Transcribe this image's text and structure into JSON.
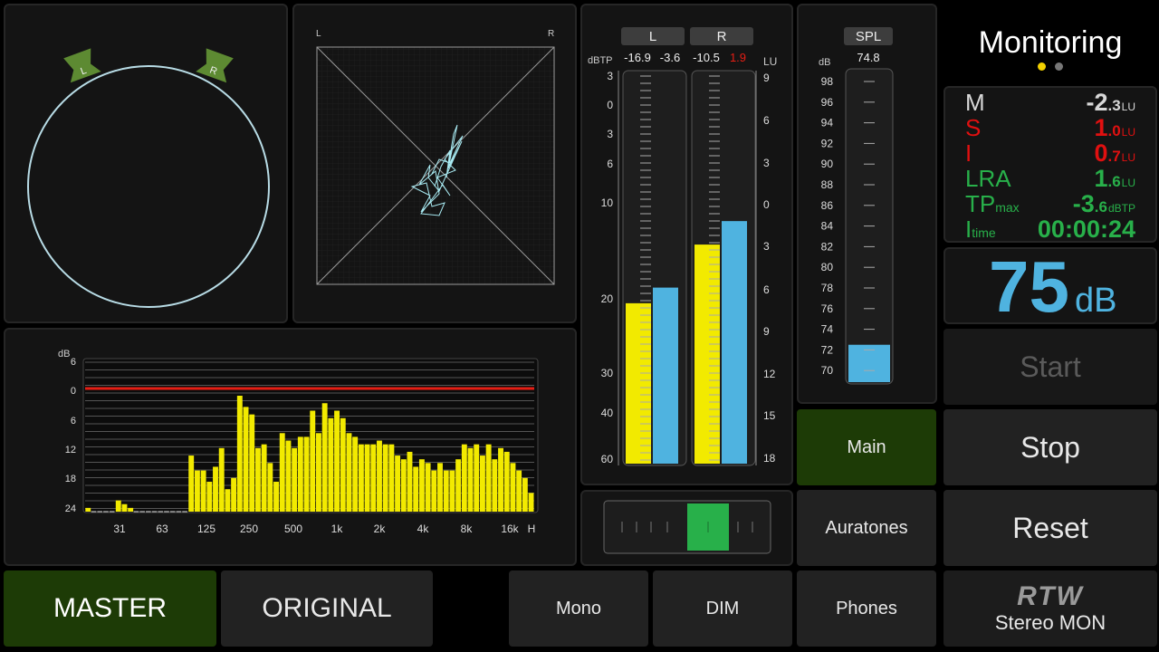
{
  "vector_scope": {
    "left_label": "L",
    "right_label": "R"
  },
  "xy_scope": {
    "left_label": "L",
    "right_label": "R"
  },
  "rta": {
    "unit": "dB",
    "y_ticks": [
      "6",
      "0",
      "6",
      "12",
      "18",
      "24"
    ],
    "x_ticks": [
      "31",
      "63",
      "125",
      "250",
      "500",
      "1k",
      "2k",
      "4k",
      "8k",
      "16k",
      "H"
    ],
    "bands": [
      1,
      0,
      0,
      0,
      0,
      3,
      2,
      1,
      0,
      0,
      0,
      0,
      0,
      0,
      0,
      0,
      0,
      15,
      11,
      11,
      8,
      12,
      17,
      6,
      9,
      31,
      28,
      26,
      17,
      18,
      13,
      8,
      21,
      19,
      17,
      20,
      20,
      27,
      21,
      29,
      25,
      27,
      25,
      21,
      20,
      18,
      18,
      18,
      19,
      18,
      18,
      15,
      14,
      16,
      12,
      14,
      13,
      11,
      13,
      11,
      11,
      14,
      18,
      17,
      18,
      15,
      18,
      14,
      17,
      16,
      13,
      11,
      9,
      5
    ],
    "colors": {
      "bar": "#f2ea00",
      "ref_line": "#e61e14"
    }
  },
  "ppm": {
    "channels": [
      "L",
      "R"
    ],
    "peak_values": [
      "-16.9",
      "-3.6",
      "-10.5",
      "1.9"
    ],
    "unit_left": "dBTP",
    "unit_right": "LU",
    "scale_left": [
      "3",
      "0",
      "3",
      "6",
      "10",
      "20",
      "30",
      "40",
      "60"
    ],
    "scale_right": [
      "9",
      "6",
      "3",
      "0",
      "3",
      "6",
      "9",
      "12",
      "15",
      "18"
    ],
    "bar_levels": [
      0.41,
      0.45,
      0.56,
      0.62
    ],
    "colors": {
      "peak": "#f2ea00",
      "loudness": "#4fb3e0",
      "over": "#e61e14"
    }
  },
  "spl": {
    "label": "SPL",
    "unit": "dB",
    "value": "74.8",
    "scale": [
      "98",
      "96",
      "94",
      "92",
      "90",
      "88",
      "86",
      "84",
      "82",
      "80",
      "78",
      "76",
      "74",
      "72",
      "70"
    ],
    "level": 0.12
  },
  "header": {
    "title": "Monitoring",
    "page_dots": [
      true,
      false
    ]
  },
  "loudness": {
    "rows": [
      {
        "label": "M",
        "sub": "",
        "big": "-2",
        "small": ".3",
        "unit": "LU",
        "color": "#d8d8d8"
      },
      {
        "label": "S",
        "sub": "",
        "big": "1",
        "small": ".0",
        "unit": "LU",
        "color": "#e01010"
      },
      {
        "label": "I",
        "sub": "",
        "big": "0",
        "small": ".7",
        "unit": "LU",
        "color": "#e01010"
      },
      {
        "label": "LRA",
        "sub": "",
        "big": "1",
        "small": ".6",
        "unit": "LU",
        "color": "#28b04a"
      },
      {
        "label": "TP",
        "sub": "max",
        "big": "-3",
        "small": ".6",
        "unit": "dBTP",
        "color": "#28b04a"
      },
      {
        "label": "I",
        "sub": "time",
        "big": "00:00:24",
        "small": "",
        "unit": "",
        "color": "#28b04a"
      }
    ]
  },
  "spl_display": {
    "value": "75",
    "unit": "dB"
  },
  "buttons": {
    "start": "Start",
    "stop": "Stop",
    "reset": "Reset",
    "main": "Main",
    "auratones": "Auratones",
    "master": "MASTER",
    "original": "ORIGINAL",
    "mono": "Mono",
    "dim": "DIM",
    "phones": "Phones"
  },
  "brand": {
    "logo": "RTW",
    "product": "Stereo MON"
  },
  "fader": {
    "level": 0.5
  }
}
